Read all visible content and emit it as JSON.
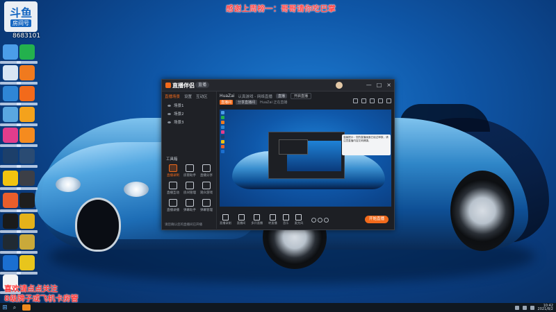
{
  "overlay": {
    "logo_text": "斗鱼",
    "logo_tag": "房间号",
    "room_id": "8683101",
    "top_banner": "感谢上周榜一：哥哥请你吃巴掌",
    "bottom_line1": "喜欢请点点关注",
    "bottom_line2": "8级牌子或飞机卡房管"
  },
  "app": {
    "name": "直播伴侣",
    "pill": "直播",
    "window_controls": [
      "—",
      "□",
      "×"
    ],
    "sidebar": {
      "tabs": [
        "直播场景",
        "设置",
        "互动区"
      ],
      "scenes": [
        "场景1",
        "场景2",
        "场景3"
      ],
      "tools_label": "工具箱",
      "tools": [
        {
          "label": "直播录制",
          "hot": true
        },
        {
          "label": "房管助手",
          "hot": false
        },
        {
          "label": "直播分享",
          "hot": false
        },
        {
          "label": "直播互动",
          "hot": false
        },
        {
          "label": "房间管理",
          "hot": false
        },
        {
          "label": "观众游戏",
          "hot": false
        },
        {
          "label": "直播录播",
          "hot": false
        },
        {
          "label": "弹幕助手",
          "hot": false
        },
        {
          "label": "弹幕管理",
          "hot": false
        }
      ],
      "footer": "请您确认您的直播间已开播"
    },
    "main": {
      "title": "HuaZai",
      "subtitle": "认真游戏 - 网络直播",
      "chip": "直播",
      "link": "开启直播",
      "sub_orange": "直播间",
      "sub_tab": "分享直播间",
      "sub_text": "HuaZai 正在直播",
      "preview_tip": "温馨提示：您的直播画面已经过审核，请注意直播内容文明健康。"
    },
    "controls": [
      {
        "label": "直播录制"
      },
      {
        "label": "直播间"
      },
      {
        "label": "多开直播"
      },
      {
        "label": "转直播"
      },
      {
        "label": "音乐"
      },
      {
        "label": "麦克风"
      }
    ],
    "go_live": "开始直播"
  },
  "taskbar": {
    "clock_time": "10:42",
    "clock_date": "2021/8/2"
  }
}
